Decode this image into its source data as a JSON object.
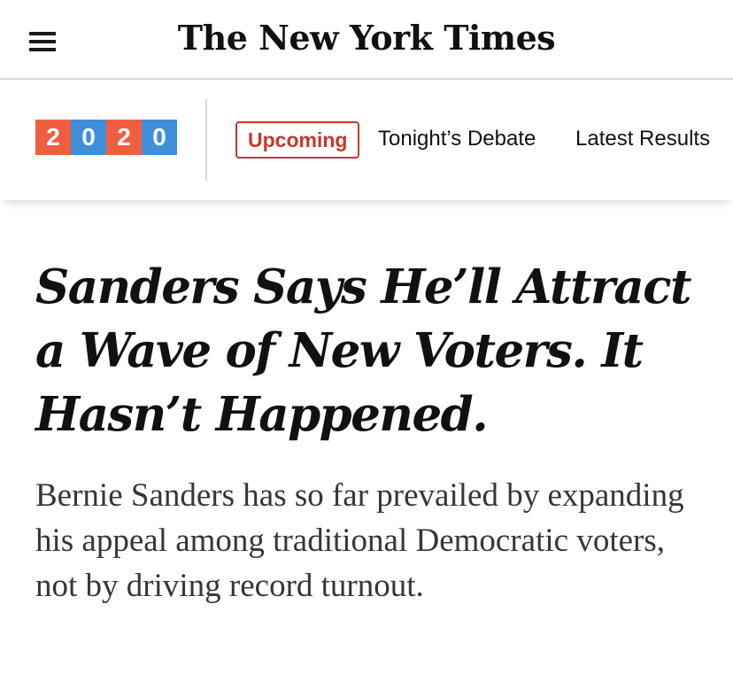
{
  "masthead": {
    "logo_text": "The New York Times",
    "menu_icon": "hamburger-menu-icon"
  },
  "election_bar": {
    "year_digits": [
      "2",
      "0",
      "2",
      "0"
    ],
    "colors": {
      "orange": "#f05e41",
      "blue": "#3f8ed9",
      "upcoming_red": "#c4382a"
    },
    "upcoming_label": "Upcoming",
    "debate_label": "Tonight’s Debate",
    "results_label": "Latest Results"
  },
  "article": {
    "headline": "Sanders Says He’ll Attract a Wave of New Voters. It Hasn’t Happened.",
    "summary": "Bernie Sanders has so far prevailed by expanding his appeal among traditional Democratic voters, not by driving record turnout."
  }
}
